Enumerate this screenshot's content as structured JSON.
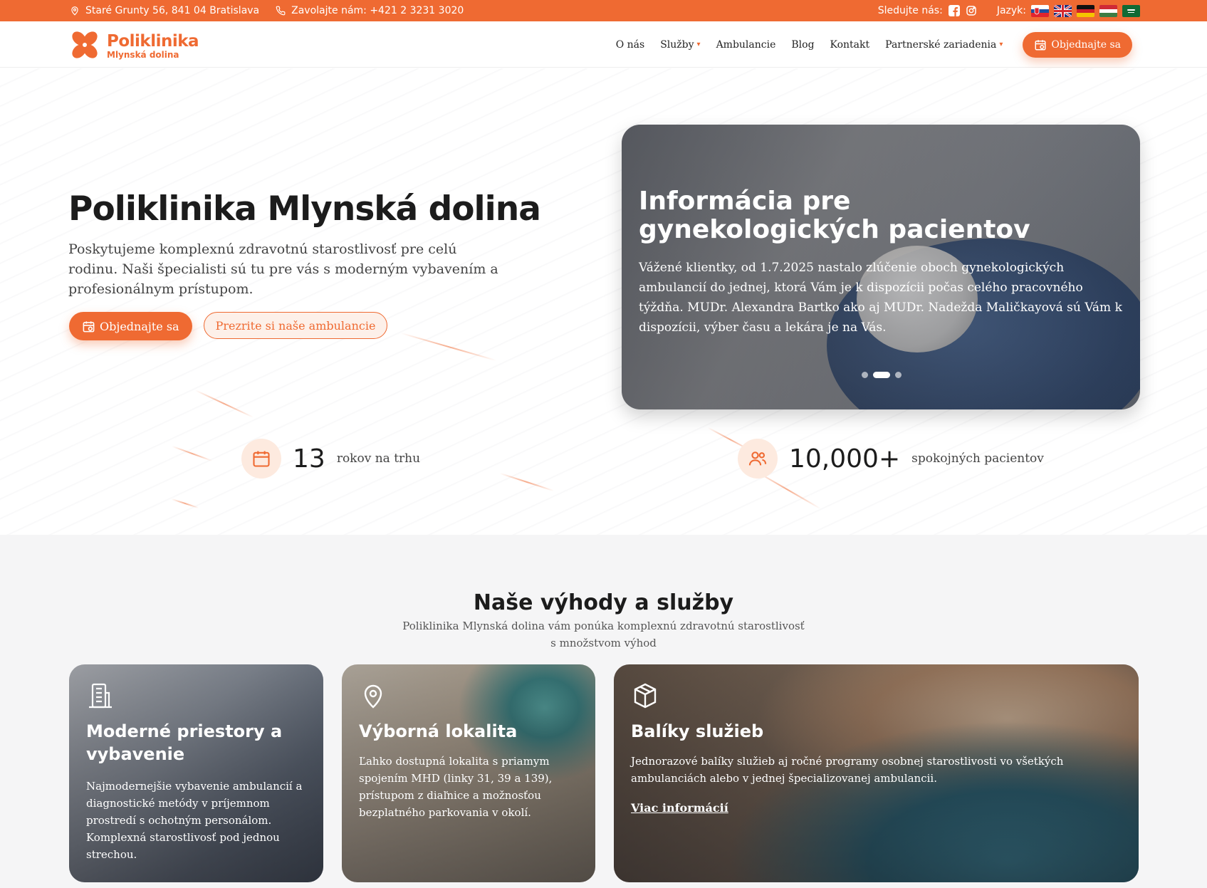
{
  "colors": {
    "accent": "#ef6a32",
    "accent_light": "#fdeadf"
  },
  "topbar": {
    "address": "Staré Grunty 56, 841 04 Bratislava",
    "phone": "Zavolajte nám:  +421 2 3231 3020",
    "follow_label": "Sledujte nás:",
    "social": [
      "facebook-icon",
      "instagram-icon"
    ],
    "language_label": "Jazyk:",
    "languages": [
      "sk",
      "en",
      "de",
      "hu",
      "sa"
    ]
  },
  "nav": {
    "logo_line1": "Poliklinika",
    "logo_line2": "Mlynská dolina",
    "items": [
      {
        "label": "O nás"
      },
      {
        "label": "Služby"
      },
      {
        "label": "Ambulancie"
      },
      {
        "label": "Blog"
      },
      {
        "label": "Kontakt"
      },
      {
        "label": "Partnerské zariadenia"
      }
    ],
    "cta": "Objednajte sa"
  },
  "hero": {
    "title": "Poliklinika Mlynská dolina",
    "lead": "Poskytujeme komplexnú zdravotnú starostlivosť pre celú rodinu. Naši špecialisti sú tu pre vás s moderným vybavením a profesionálnym prístupom.",
    "cta_primary": "Objednajte sa",
    "cta_secondary": "Prezrite si naše ambulancie",
    "slider": {
      "title": "Informácia pre gynekologických pacientov",
      "text": "Vážené klientky, od 1.7.2025 nastalo zlúčenie oboch gynekologických ambulancií do jednej, ktorá Vám je k dispozícii počas celého pracovného týždňa. MUDr. Alexandra Bartko ako aj MUDr. Nadežda Maličkayová sú Vám k dispozícii, výber času a lekára je na Vás.",
      "slide_count": 3,
      "active_slide": 2
    },
    "stats": [
      {
        "value": "13",
        "label": "rokov na trhu",
        "icon": "calendar-icon"
      },
      {
        "value": "10,000+",
        "label": "spokojných pacientov",
        "icon": "users-icon"
      }
    ]
  },
  "services": {
    "title": "Naše výhody a služby",
    "subtitle": "Poliklinika Mlynská dolina vám ponúka komplexnú zdravotnú starostlivosť s množstvom výhod",
    "cards": [
      {
        "icon": "building-icon",
        "title": "Moderné priestory a vybavenie",
        "text": "Najmodernejšie vybavenie ambulancií a diagnostické metódy v príjemnom prostredí s ochotným personálom. Komplexná starostlivosť pod jednou strechou."
      },
      {
        "icon": "map-pin-icon",
        "title": "Výborná lokalita",
        "text": "Ľahko dostupná lokalita s priamym spojením MHD (linky 31, 39 a 139), prístupom z diaľnice a možnosťou bezplatného parkovania v okolí."
      },
      {
        "icon": "box-icon",
        "title": "Balíky služieb",
        "text": "Jednorazové balíky služieb aj ročné programy osobnej starostlivosti vo všetkých ambulanciách alebo v jednej špecializovanej ambulancii.",
        "link": "Viac informácií"
      }
    ]
  }
}
